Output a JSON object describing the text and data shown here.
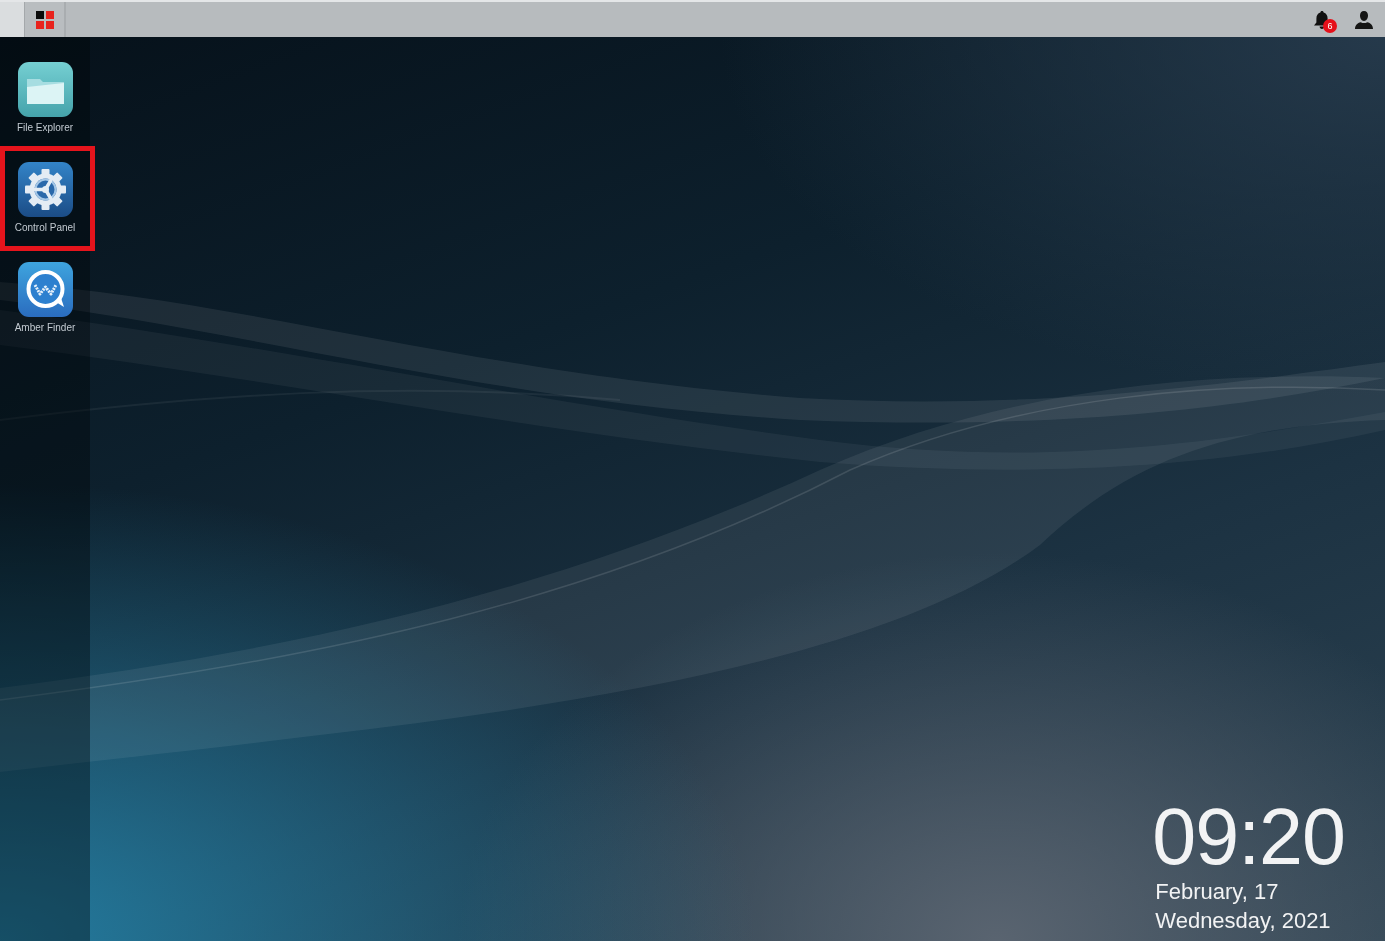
{
  "taskbar": {
    "notifications": {
      "count": "6"
    }
  },
  "apps": [
    {
      "label": "File Explorer",
      "kind": "folder",
      "highlighted": false
    },
    {
      "label": "Control Panel",
      "kind": "gear",
      "highlighted": true
    },
    {
      "label": "Amber Finder",
      "kind": "chat",
      "highlighted": false
    }
  ],
  "clock": {
    "time": "09:20",
    "date": "February, 17",
    "weekday": "Wednesday, 2021"
  }
}
